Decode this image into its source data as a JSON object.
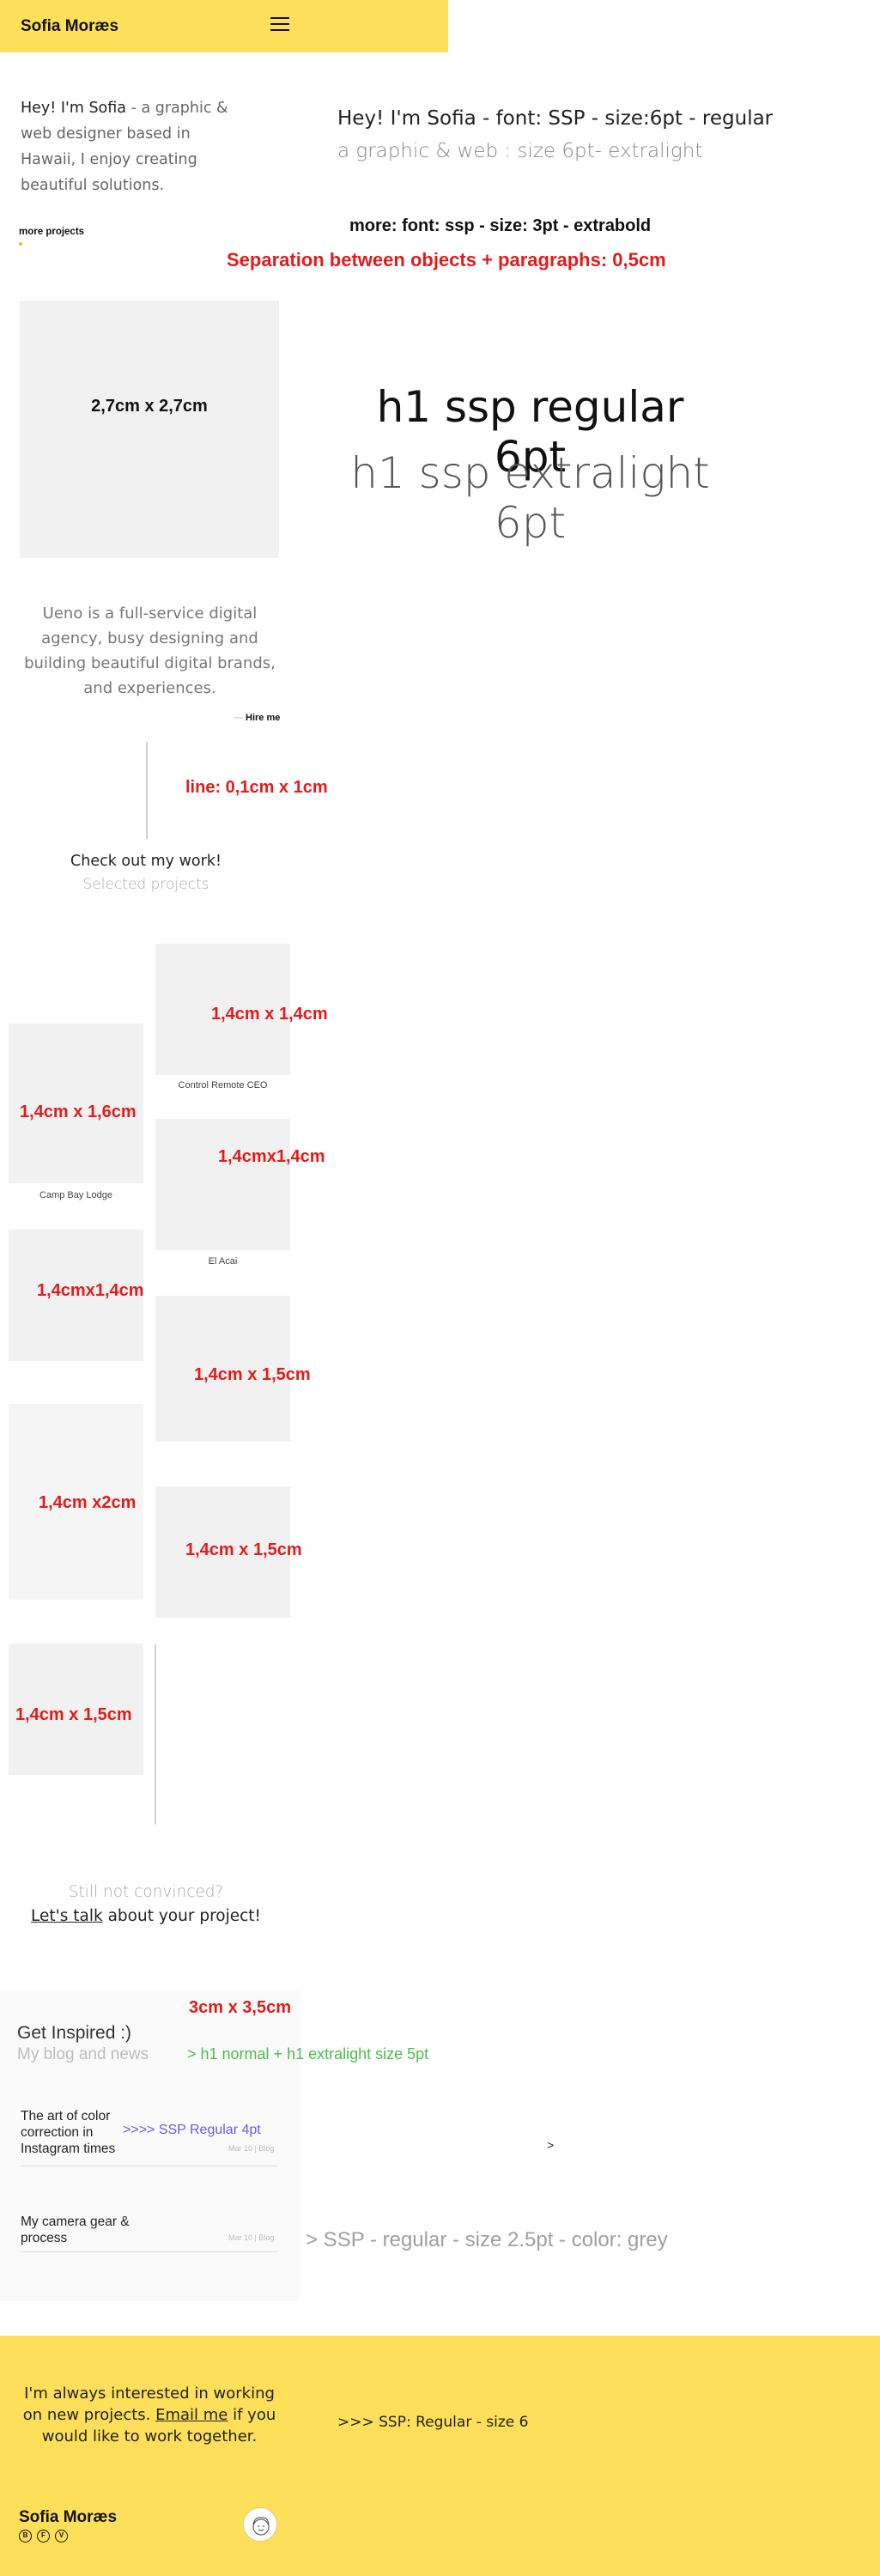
{
  "header": {
    "brand": "Sofia Moræs",
    "menu_icon": "hamburger-icon"
  },
  "intro": {
    "greeting": "Hey! I'm Sofia",
    "rest": " - a graphic & web designer based in Hawaii, I enjoy creating beautiful solutions."
  },
  "more_projects": "more projects",
  "notes": {
    "intro_font": "Hey! I'm Sofia - font: SSP - size:6pt - regular",
    "intro_sub": "a graphic & web : size 6pt- extralight",
    "more_font": "more: font: ssp - size: 3pt - extrabold",
    "separation": "Separation between objects + paragraphs: 0,5cm",
    "portrait_size": "2,7cm x 2,7cm",
    "h1_regular": "h1 ssp regular 6pt",
    "h1_light": "h1 ssp extralight 6pt",
    "line_size": "line: 0,1cm x 1cm",
    "blog_size": "3cm x 3,5cm",
    "blog_h1": "> h1 normal + h1 extralight size 5pt",
    "blog_font": ">>>> SSP Regular 4pt",
    "arrow": ">",
    "ssp_grey": "> SSP - regular - size 2.5pt - color: grey",
    "footer_font": ">>> SSP: Regular - size 6"
  },
  "about": "Ueno is a full-service digital agency, busy designing and building beautiful digital brands, and experiences.",
  "hire_me": "Hire me",
  "work": {
    "title": "Check out my work!",
    "subtitle": "Selected projects"
  },
  "projects": [
    {
      "size": "1,4cm x 1,4cm",
      "caption": "Control Remote CEO"
    },
    {
      "size": "1,4cm x 1,6cm",
      "caption": "Camp Bay Lodge"
    },
    {
      "size": "1,4cmx1,4cm",
      "caption": "El Acai"
    },
    {
      "size": "1,4cmx1,4cm",
      "caption": ""
    },
    {
      "size": "1,4cm x 1,5cm",
      "caption": ""
    },
    {
      "size": "1,4cm x2cm",
      "caption": ""
    },
    {
      "size": "1,4cm x 1,5cm",
      "caption": ""
    },
    {
      "size": "1,4cm x 1,5cm",
      "caption": ""
    }
  ],
  "convince": {
    "still": "Still not convinced?",
    "talk_link": "Let's talk",
    "talk_rest": " about your project!"
  },
  "blog": {
    "title": "Get Inspired :)",
    "subtitle": "My blog and news",
    "posts": [
      {
        "title": "The art of color correction in Instagram times",
        "meta": "Mar 10 | Blog"
      },
      {
        "title": "My camera gear & process",
        "meta": "Mar 10 | Blog"
      }
    ]
  },
  "footer": {
    "text_before": "I'm always interested in working on new projects. ",
    "email_link": "Email me",
    "text_after": " if you would like to work together.",
    "brand": "Sofia Moræs",
    "social": [
      "B",
      "F",
      "V"
    ]
  }
}
